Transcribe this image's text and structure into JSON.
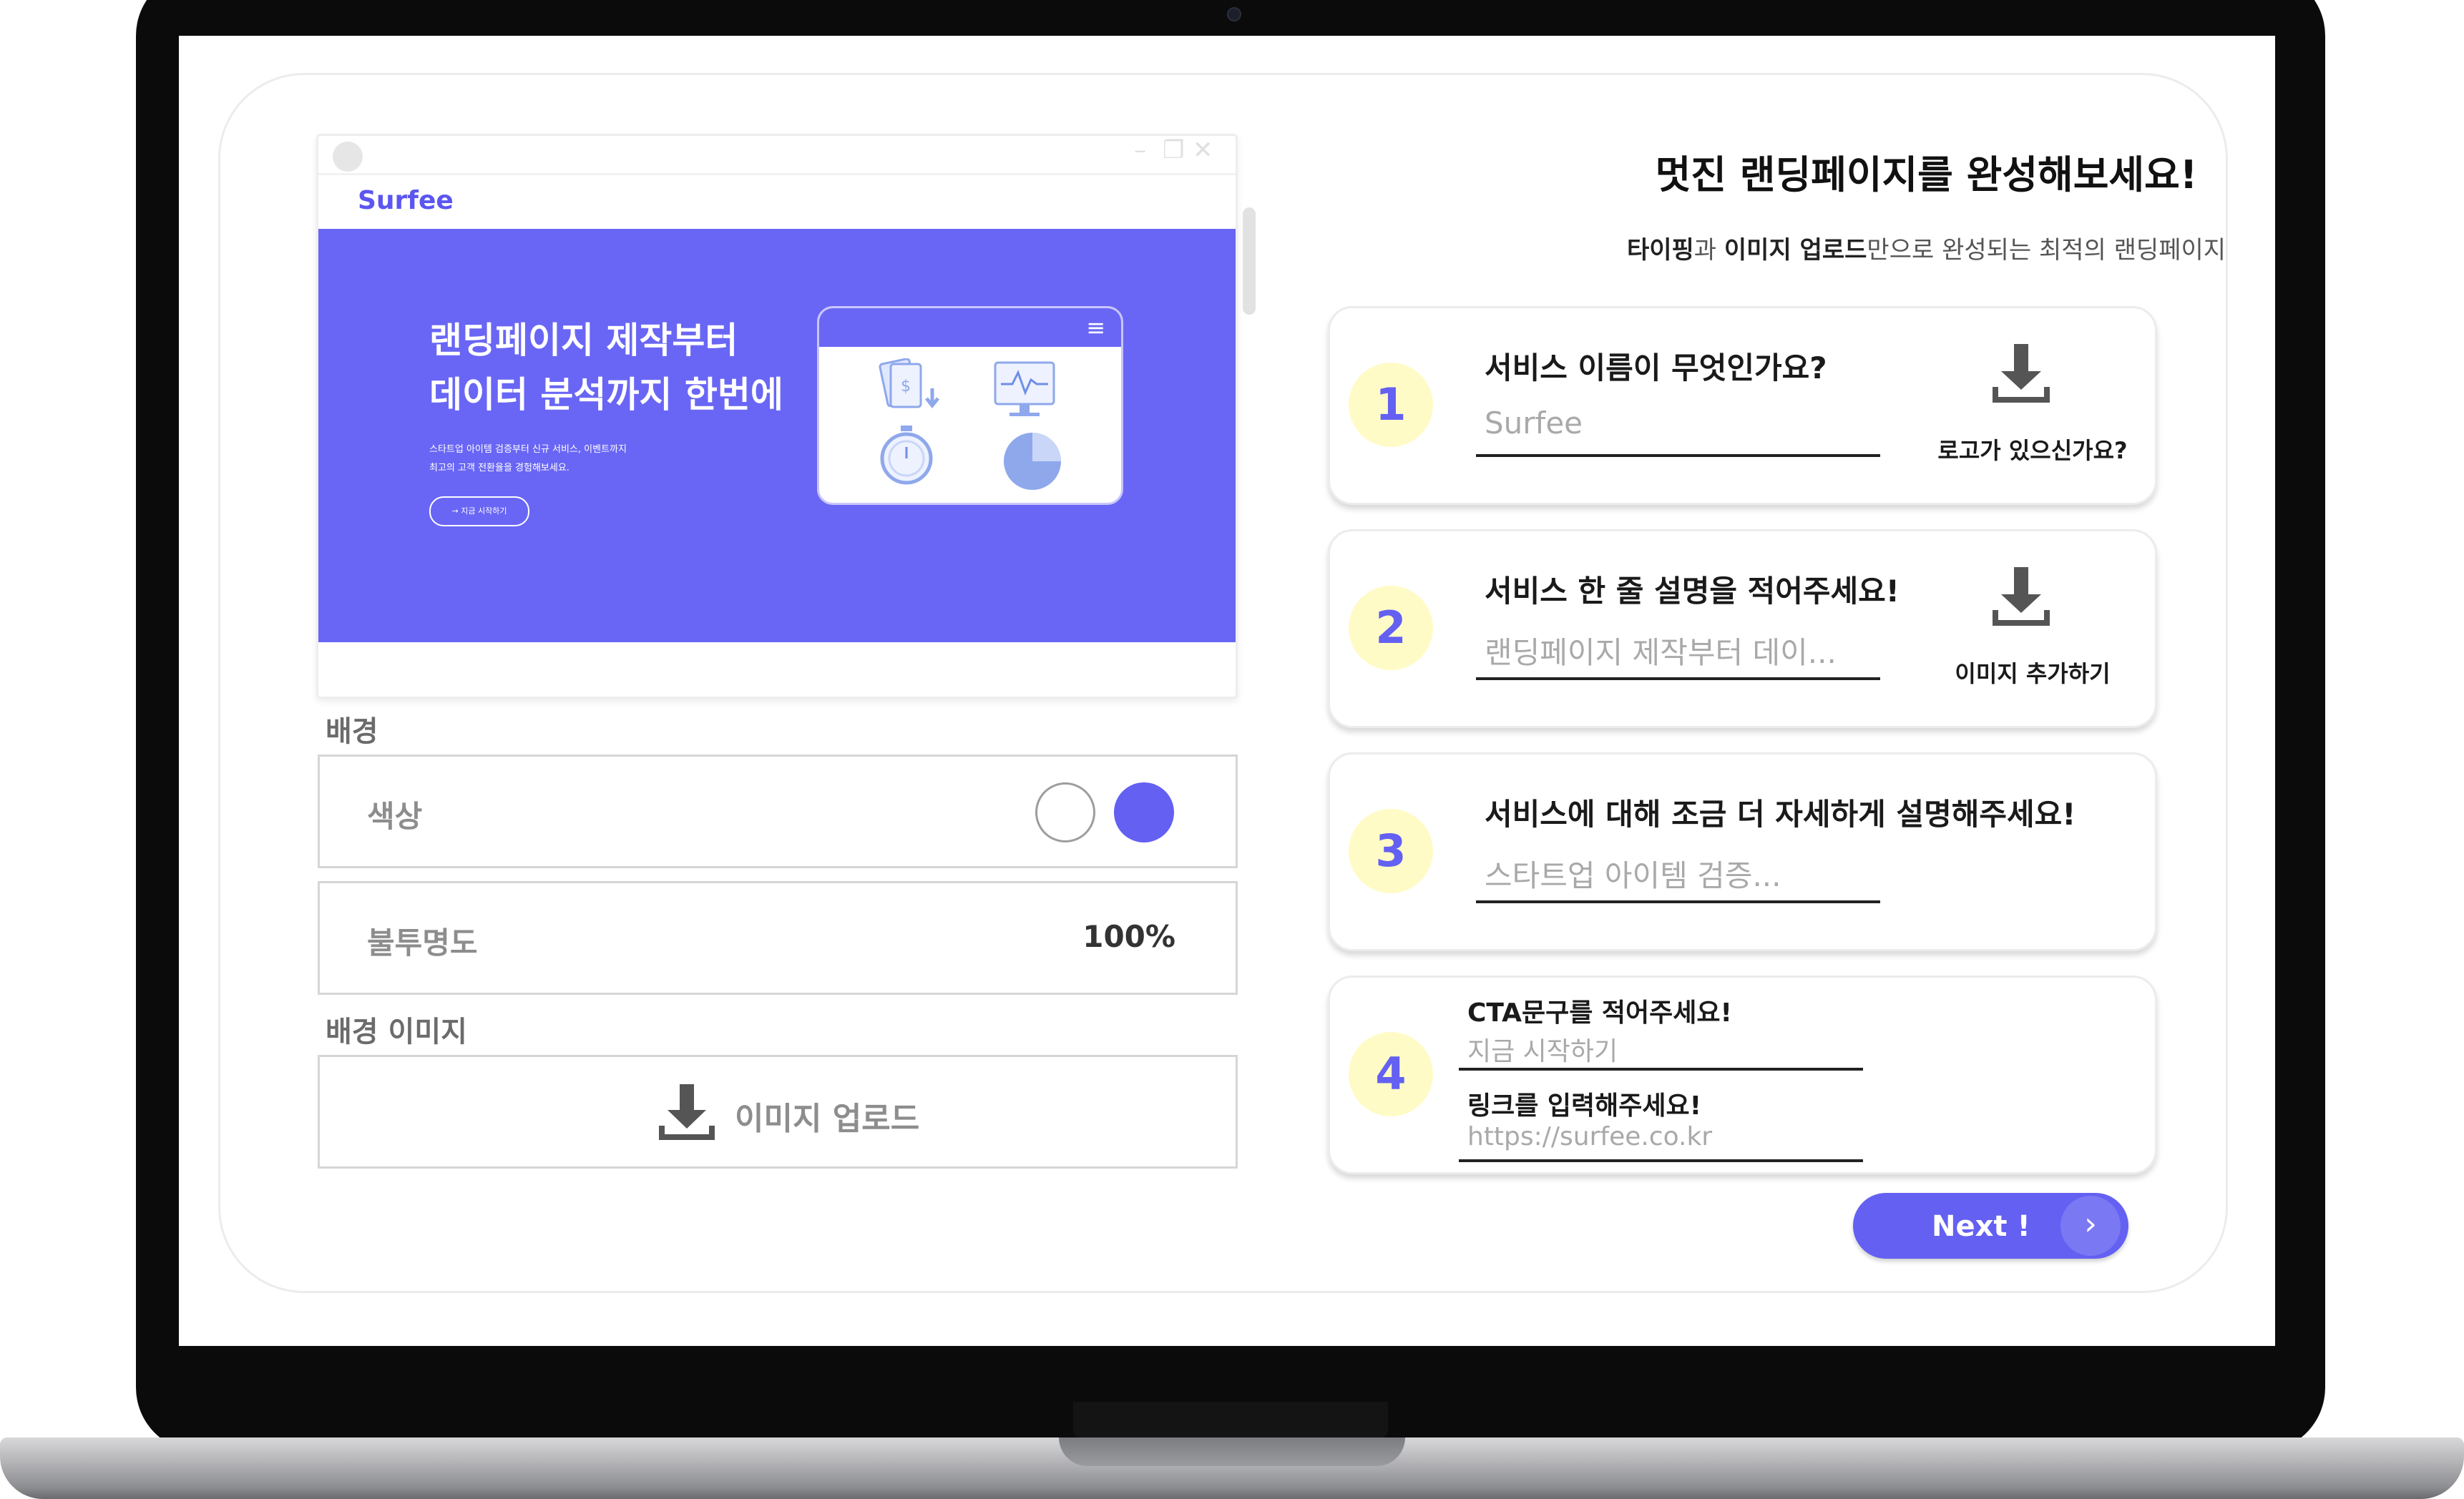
{
  "preview": {
    "brand": "Surfee",
    "hero_title": "랜딩페이지 제작부터\n데이터 분석까지 한번에",
    "hero_desc": "스타트업 아이템 검증부터 신규 서비스, 이벤트까지\n최고의 고객 전환율을 경험해보세요.",
    "hero_button": "→ 지금 시작하기",
    "window_controls": [
      "minimize-icon",
      "restore-icon",
      "close-icon"
    ],
    "illustration_icons": [
      "money-icon",
      "monitor-chart-icon",
      "stopwatch-icon",
      "pie-chart-icon"
    ]
  },
  "settings": {
    "background_label": "배경",
    "color_label": "색상",
    "color_options": [
      "#ffffff",
      "#6360f2"
    ],
    "opacity_label": "불투명도",
    "opacity_value": "100%",
    "bg_image_label": "배경 이미지",
    "upload_label": "이미지 업로드"
  },
  "header": {
    "title": "멋진 랜딩페이지를 완성해보세요!",
    "subtitle_parts": [
      "타이핑",
      "과 ",
      "이미지 업로드",
      "만으로 완성되는 최적의 랜딩페이지"
    ]
  },
  "steps": [
    {
      "num": "1",
      "question": "서비스 이름이 무엇인가요?",
      "answer": "Surfee",
      "side_label": "로고가 있으신가요?"
    },
    {
      "num": "2",
      "question": "서비스 한 줄 설명을 적어주세요!",
      "answer": "랜딩페이지 제작부터 데이...",
      "side_label": "이미지 추가하기"
    },
    {
      "num": "3",
      "question": "서비스에 대해 조금 더 자세하게 설명해주세요!",
      "answer": "스타트업 아이템 검증..."
    },
    {
      "num": "4",
      "cta_question": "CTA문구를 적어주세요!",
      "cta_answer": "지금 시작하기",
      "link_question": "링크를 입력해주세요!",
      "link_answer": "https://surfee.co.kr"
    }
  ],
  "next_button": {
    "label": "Next !",
    "arrow": "›"
  },
  "colors": {
    "accent": "#6360f2",
    "step_badge": "#fffbc7"
  }
}
